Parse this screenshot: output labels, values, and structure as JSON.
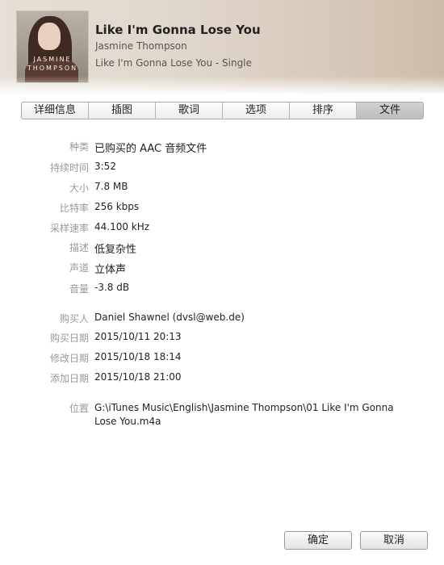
{
  "header": {
    "title": "Like I'm Gonna Lose You",
    "artist": "Jasmine Thompson",
    "album": "Like I'm Gonna Lose You - Single",
    "cover_text_line1": "JASMINE",
    "cover_text_line2": "THOMPSON"
  },
  "tabs": [
    {
      "label": "详细信息"
    },
    {
      "label": "插图"
    },
    {
      "label": "歌词"
    },
    {
      "label": "选项"
    },
    {
      "label": "排序"
    },
    {
      "label": "文件",
      "active": true
    }
  ],
  "file_info": {
    "kind_label": "种类",
    "kind_value": "已购买的 AAC 音频文件",
    "duration_label": "持续时间",
    "duration_value": "3:52",
    "size_label": "大小",
    "size_value": "7.8 MB",
    "bitrate_label": "比特率",
    "bitrate_value": "256 kbps",
    "samplerate_label": "采样速率",
    "samplerate_value": "44.100 kHz",
    "profile_label": "描述",
    "profile_value": "低复杂性",
    "channels_label": "声道",
    "channels_value": "立体声",
    "volume_label": "音量",
    "volume_value": "-3.8 dB",
    "purchaser_label": "购买人",
    "purchaser_value": "Daniel Shawnel (dvsl@web.de)",
    "purchase_date_label": "购买日期",
    "purchase_date_value": "2015/10/11 20:13",
    "modified_label": "修改日期",
    "modified_value": "2015/10/18 18:14",
    "added_label": "添加日期",
    "added_value": "2015/10/18 21:00",
    "location_label": "位置",
    "location_value": "G:\\iTunes Music\\English\\Jasmine Thompson\\01 Like I'm Gonna Lose You.m4a"
  },
  "buttons": {
    "ok": "确定",
    "cancel": "取消"
  }
}
